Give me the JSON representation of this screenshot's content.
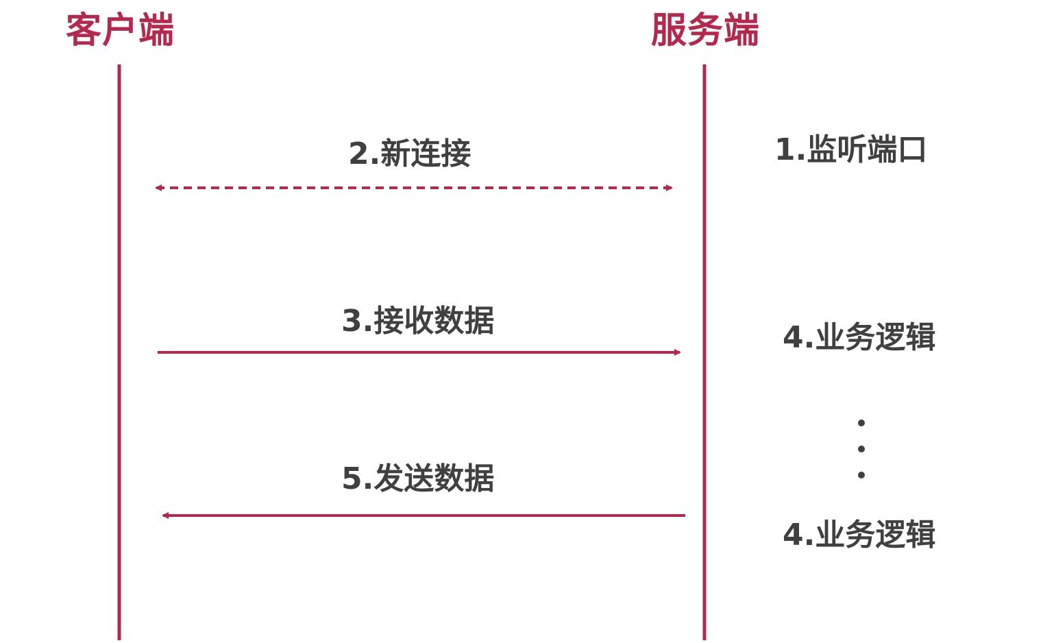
{
  "diagram": {
    "client_title": "客户端",
    "server_title": "服务端",
    "messages": {
      "connect": "2.新连接",
      "receive": "3.接收数据",
      "send": "5.发送数据"
    },
    "server_side": {
      "listen": "1.监听端口",
      "logic_1": "4.业务逻辑",
      "logic_2": "4.业务逻辑"
    },
    "colors": {
      "accent": "#b5274d",
      "text": "#404040",
      "background": "#ffffff"
    }
  }
}
